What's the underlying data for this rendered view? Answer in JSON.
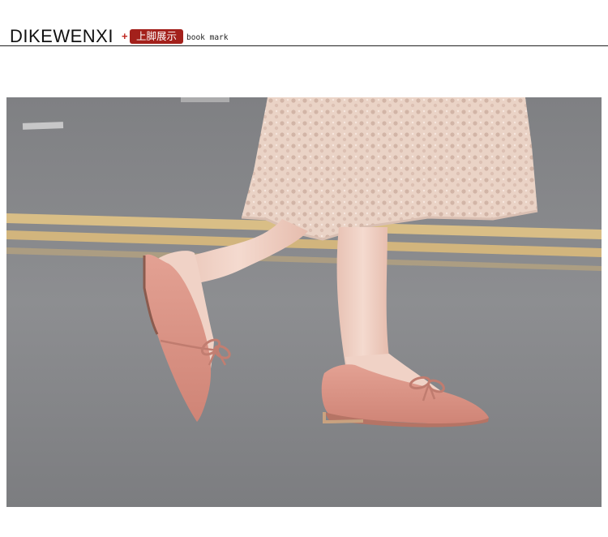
{
  "header": {
    "brand": "DIKEWENXI",
    "plus": "+",
    "badge": "上脚展示",
    "subtitle": "book mark"
  },
  "photo": {
    "subject": "pink-suede-pointed-flats-with-bow",
    "colors": {
      "asphalt": "#86878a",
      "road_line": "#d9be86",
      "shoe": "#d98f82",
      "skin": "#f0d2c6",
      "lace": "#ead3c6"
    }
  }
}
